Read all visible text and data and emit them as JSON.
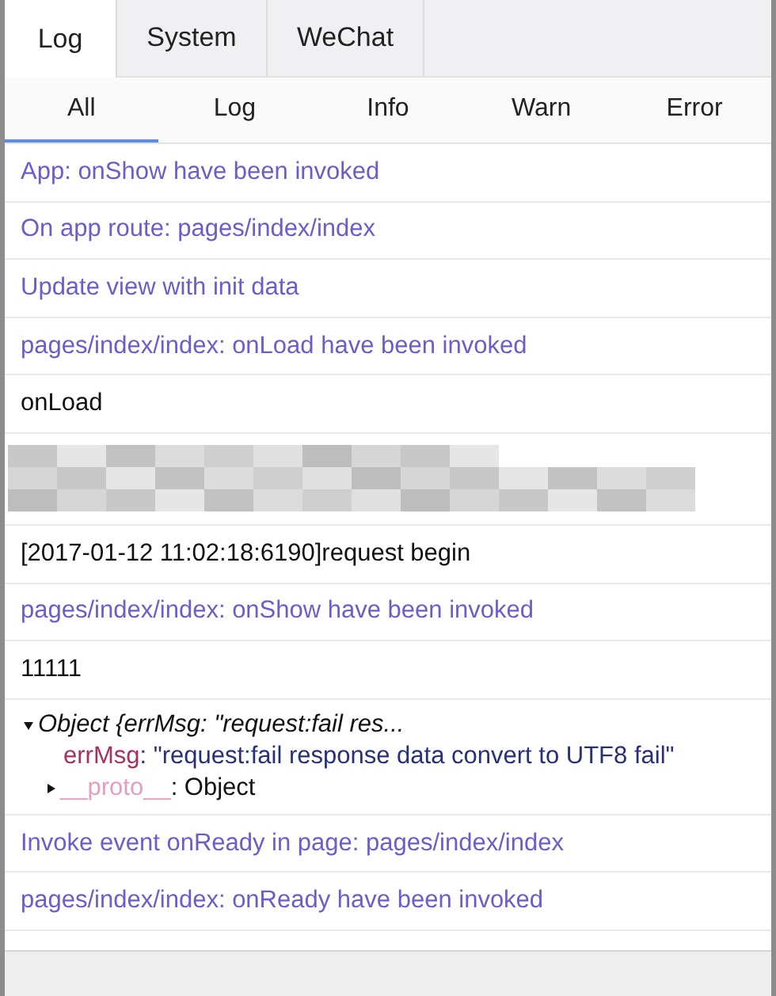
{
  "tabs": [
    {
      "label": "Log",
      "selected": true
    },
    {
      "label": "System",
      "selected": false
    },
    {
      "label": "WeChat",
      "selected": false
    }
  ],
  "filters": [
    {
      "label": "All",
      "selected": true
    },
    {
      "label": "Log",
      "selected": false
    },
    {
      "label": "Info",
      "selected": false
    },
    {
      "label": "Warn",
      "selected": false
    },
    {
      "label": "Error",
      "selected": false
    }
  ],
  "entries": [
    {
      "kind": "system",
      "text": "App: onShow have been invoked"
    },
    {
      "kind": "system",
      "text": "On app route: pages/index/index"
    },
    {
      "kind": "system",
      "text": "Update view with init data"
    },
    {
      "kind": "system",
      "text": "pages/index/index: onLoad have been invoked"
    },
    {
      "kind": "log",
      "text": "onLoad"
    },
    {
      "kind": "redacted"
    },
    {
      "kind": "log",
      "text": "[2017-01-12 11:02:18:6190]request begin"
    },
    {
      "kind": "system",
      "text": "pages/index/index: onShow have been invoked"
    },
    {
      "kind": "log",
      "text": "11111"
    },
    {
      "kind": "object",
      "summary": "Object {errMsg: \"request:fail res...",
      "expanded": true,
      "properties": [
        {
          "key": "errMsg",
          "value": ": \"request:fail response data convert to UTF8 fail\""
        }
      ],
      "proto": {
        "key": "__proto__",
        "value": ": Object",
        "expanded": false
      }
    },
    {
      "kind": "system",
      "text": "Invoke event onReady in page: pages/index/index"
    },
    {
      "kind": "system",
      "text": "pages/index/index: onReady have been invoked"
    }
  ]
}
